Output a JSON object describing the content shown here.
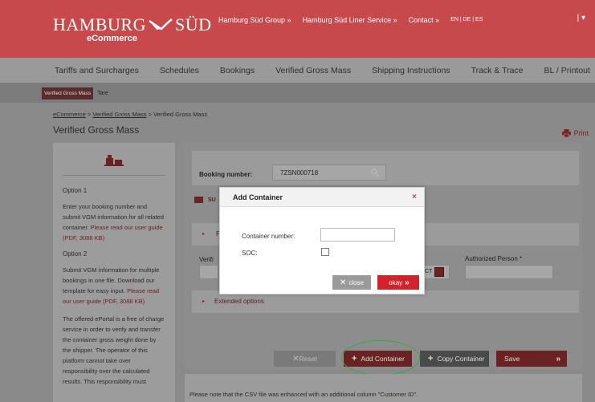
{
  "header": {
    "logo_left": "HAMBURG",
    "logo_right": "SÜD",
    "logo_sub": "eCommerce",
    "links": [
      "Hamburg Süd Group »",
      "Hamburg Süd Liner Service »",
      "Contact »"
    ],
    "languages": "EN | DE | ES",
    "menu_toggle": "| ▾"
  },
  "nav": {
    "items": [
      "Tariffs and Surcharges",
      "Schedules",
      "Bookings",
      "Verified Gross Mass",
      "Shipping Instructions",
      "Track & Trace",
      "BL / Printout"
    ]
  },
  "subnav": {
    "active": "Verified Gross Mass",
    "other": "Tare"
  },
  "breadcrumb": {
    "home": "eCommerce",
    "sep1": " > ",
    "section": "Verified Gross Mass",
    "sep2": " > ",
    "current": "Verified Gross Mass"
  },
  "page": {
    "title": "Verified Gross Mass",
    "print_label": "Print"
  },
  "left_panel": {
    "option1_heading": "Option 1",
    "option1_text": "Enter your booking number and submit VGM information for all related container.",
    "option1_link": "Please read our user guide (PDF, 3088 KB)",
    "option2_heading": "Option 2",
    "option2_text": "Submit VGM information for multiple bookings in one file. Download our template for easy input.",
    "option2_link": "Please read our user guide (PDF, 3088 KB)",
    "disclaimer": "The offered ePortal is a free of charge service in order to verify and transfer the container gross weight done by the shipper. The operator of this platform cannot take over responsibility over the calculated results. This responsibility must"
  },
  "main": {
    "booking_label": "Booking number:",
    "booking_value": "7ZSN000718",
    "sub_label": "SU",
    "row_f_label": "F",
    "verif_label": "Verifi",
    "ct_label": "CT",
    "authorized_label": "Authorized Person *",
    "extended_label": "Extended options",
    "buttons": {
      "reset": "Reset",
      "add_container": "Add Container",
      "copy_container": "Copy Container",
      "save": "Save",
      "save_arrow": "»"
    },
    "csv_note": "Please note that the CSV file was enhanced with an additional column \"Customer ID\"."
  },
  "modal": {
    "title": "Add Container",
    "close_x": "×",
    "container_label": "Container number:",
    "container_value": "",
    "soc_label": "SOC:",
    "close_btn": "close",
    "okay_btn": "okay"
  },
  "colors": {
    "brand_red": "#c8494b",
    "okay_red": "#d2232a",
    "highlight_green": "#3da34a"
  }
}
